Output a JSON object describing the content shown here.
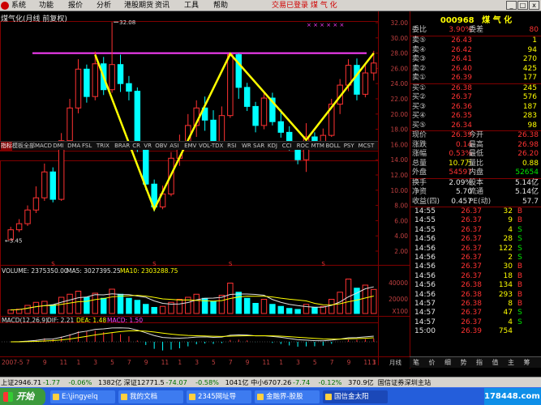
{
  "menubar": {
    "items": [
      "系统",
      "功能",
      "报价",
      "分析",
      "港股期货",
      "资讯",
      "工具",
      "帮助"
    ],
    "status": "交易已登录  煤 气 化",
    "win_min": "_",
    "win_max": "□",
    "win_close": "x"
  },
  "chart": {
    "title": "煤气化(月线 前复权)",
    "high_label": "32.08",
    "low_label": "←3.45",
    "markers": "× × × × × ×",
    "volume_legend": {
      "volume": "VOLUME: 2375350.00",
      "ma5": "MA5: 3027395.25",
      "ma10": "MA10: 2303288.75"
    },
    "macd_legend": {
      "name": "MACD(12,26,9)",
      "dif": "DIF: 2.21",
      "dea": "DEA: 1.48",
      "macd": "MACD: 1.50"
    },
    "bottom_period": "月线",
    "colors": {
      "up": "#ff3232",
      "down": "#00ffff",
      "pattern": "#ffff00",
      "resistance": "#ff40ff",
      "axis": "#800000"
    }
  },
  "chart_data": {
    "type": "candlestick",
    "price_ylim": [
      2,
      32
    ],
    "price_ticks": [
      "32.00",
      "30.00",
      "28.00",
      "26.00",
      "24.00",
      "22.00",
      "20.00",
      "18.00",
      "16.00",
      "14.00",
      "12.00",
      "10.00",
      "8.00",
      "6.00",
      "4.00",
      "2.00"
    ],
    "volume_ticks": [
      "40000",
      "20000",
      "X100"
    ],
    "x_labels": [
      "2007-5",
      "7",
      "9",
      "11",
      "1",
      "3",
      "5",
      "7",
      "9",
      "11",
      "1",
      "3",
      "5",
      "7",
      "9",
      "11",
      "1",
      "3",
      "5",
      "7",
      "9",
      "11",
      "1",
      "3"
    ],
    "resistance_level": 28.0,
    "w_pattern_points": [
      27.8,
      7.5,
      27.9,
      16.6,
      28.0
    ],
    "candles": [
      {
        "o": 3.5,
        "c": 4.8,
        "h": 5.2,
        "l": 3.45
      },
      {
        "o": 4.8,
        "c": 5.6,
        "h": 6.2,
        "l": 4.5
      },
      {
        "o": 5.6,
        "c": 7.4,
        "h": 8.0,
        "l": 5.3
      },
      {
        "o": 7.4,
        "c": 9.0,
        "h": 10.5,
        "l": 7.0
      },
      {
        "o": 9.0,
        "c": 12.4,
        "h": 13.5,
        "l": 8.6
      },
      {
        "o": 12.4,
        "c": 8.8,
        "h": 13.0,
        "l": 8.4
      },
      {
        "o": 8.8,
        "c": 16.5,
        "h": 17.5,
        "l": 8.6
      },
      {
        "o": 16.5,
        "c": 20.8,
        "h": 22.0,
        "l": 16.0
      },
      {
        "o": 20.8,
        "c": 25.9,
        "h": 27.2,
        "l": 20.1
      },
      {
        "o": 25.9,
        "c": 22.3,
        "h": 26.5,
        "l": 21.5
      },
      {
        "o": 22.3,
        "c": 26.6,
        "h": 28.2,
        "l": 21.8
      },
      {
        "o": 26.6,
        "c": 23.2,
        "h": 27.5,
        "l": 22.5
      },
      {
        "o": 23.2,
        "c": 26.5,
        "h": 32.08,
        "l": 22.8
      },
      {
        "o": 26.5,
        "c": 24.0,
        "h": 27.8,
        "l": 22.9
      },
      {
        "o": 24.0,
        "c": 23.0,
        "h": 25.0,
        "l": 21.8
      },
      {
        "o": 23.0,
        "c": 15.5,
        "h": 23.5,
        "l": 15.0
      },
      {
        "o": 15.5,
        "c": 10.8,
        "h": 16.2,
        "l": 10.0
      },
      {
        "o": 10.8,
        "c": 7.8,
        "h": 11.4,
        "l": 7.2
      },
      {
        "o": 7.8,
        "c": 9.5,
        "h": 10.6,
        "l": 7.5
      },
      {
        "o": 9.5,
        "c": 14.2,
        "h": 15.0,
        "l": 9.2
      },
      {
        "o": 14.2,
        "c": 16.0,
        "h": 17.3,
        "l": 13.2
      },
      {
        "o": 16.0,
        "c": 18.5,
        "h": 20.0,
        "l": 15.6
      },
      {
        "o": 18.5,
        "c": 20.8,
        "h": 21.8,
        "l": 17.0
      },
      {
        "o": 20.8,
        "c": 19.2,
        "h": 22.3,
        "l": 17.8
      },
      {
        "o": 19.2,
        "c": 16.4,
        "h": 20.5,
        "l": 15.5
      },
      {
        "o": 16.4,
        "c": 19.8,
        "h": 21.0,
        "l": 16.0
      },
      {
        "o": 19.8,
        "c": 27.8,
        "h": 28.1,
        "l": 19.5
      },
      {
        "o": 27.8,
        "c": 23.5,
        "h": 28.0,
        "l": 22.0
      },
      {
        "o": 23.5,
        "c": 21.0,
        "h": 24.1,
        "l": 20.4
      },
      {
        "o": 21.0,
        "c": 18.5,
        "h": 21.6,
        "l": 17.6
      },
      {
        "o": 18.5,
        "c": 22.1,
        "h": 23.0,
        "l": 18.0
      },
      {
        "o": 22.1,
        "c": 19.0,
        "h": 22.8,
        "l": 18.5
      },
      {
        "o": 19.0,
        "c": 17.6,
        "h": 20.6,
        "l": 16.9
      },
      {
        "o": 17.6,
        "c": 15.6,
        "h": 18.4,
        "l": 15.2
      },
      {
        "o": 15.6,
        "c": 14.0,
        "h": 16.3,
        "l": 13.4
      },
      {
        "o": 14.0,
        "c": 17.0,
        "h": 18.8,
        "l": 12.4
      },
      {
        "o": 17.0,
        "c": 16.3,
        "h": 17.6,
        "l": 15.8
      },
      {
        "o": 16.3,
        "c": 17.2,
        "h": 18.1,
        "l": 15.9
      },
      {
        "o": 17.2,
        "c": 21.3,
        "h": 22.0,
        "l": 17.0
      },
      {
        "o": 21.3,
        "c": 23.8,
        "h": 24.6,
        "l": 20.0
      },
      {
        "o": 23.8,
        "c": 26.4,
        "h": 27.2,
        "l": 23.0
      },
      {
        "o": 26.4,
        "c": 22.6,
        "h": 27.3,
        "l": 21.8
      },
      {
        "o": 22.6,
        "c": 25.4,
        "h": 26.7,
        "l": 22.2
      },
      {
        "o": 25.4,
        "c": 26.7,
        "h": 28.3,
        "l": 24.4
      }
    ],
    "volume": [
      3500,
      4200,
      8000,
      11000,
      12000,
      8500,
      16000,
      19000,
      22000,
      16000,
      20000,
      15000,
      24000,
      19000,
      15000,
      13000,
      9000,
      6000,
      7000,
      11000,
      14000,
      16000,
      19000,
      15000,
      12000,
      18000,
      30000,
      21000,
      15000,
      10000,
      14000,
      9000,
      7000,
      5000,
      4000,
      9000,
      6000,
      7000,
      14000,
      21000,
      34000,
      25000,
      28000,
      23750
    ]
  },
  "indicator_tabs": [
    "指标",
    "模板",
    "全部",
    "MACD",
    "DMI",
    "DMA",
    "FSL",
    "TRIX",
    "BRAR",
    "CR",
    "VR",
    "OBV",
    "ASI",
    "EMV",
    "VOL-TDX",
    "RSI",
    "WR",
    "SAR",
    "KDJ",
    "CCI",
    "ROC",
    "MTM",
    "BOLL",
    "PSY",
    "MCST"
  ],
  "quote": {
    "code": "000968",
    "name": "煤 气 化",
    "webi_label": "委比",
    "webi": "3.90%",
    "weicha_label": "委差",
    "weicha": "80",
    "sells": [
      {
        "label": "卖⑤",
        "price": "26.43",
        "vol": "1"
      },
      {
        "label": "卖④",
        "price": "26.42",
        "vol": "94"
      },
      {
        "label": "卖③",
        "price": "26.41",
        "vol": "270"
      },
      {
        "label": "卖②",
        "price": "26.40",
        "vol": "425"
      },
      {
        "label": "卖①",
        "price": "26.39",
        "vol": "177"
      }
    ],
    "buys": [
      {
        "label": "买①",
        "price": "26.38",
        "vol": "245"
      },
      {
        "label": "买②",
        "price": "26.37",
        "vol": "576"
      },
      {
        "label": "买③",
        "price": "26.36",
        "vol": "187"
      },
      {
        "label": "买④",
        "price": "26.35",
        "vol": "283"
      },
      {
        "label": "买⑤",
        "price": "26.34",
        "vol": "98"
      }
    ],
    "stats": [
      {
        "l1": "现价",
        "v1": "26.39",
        "c1": "red",
        "l2": "今开",
        "v2": "26.38",
        "c2": "red"
      },
      {
        "l1": "涨跌",
        "v1": "0.14",
        "c1": "red",
        "l2": "最高",
        "v2": "26.98",
        "c2": "red"
      },
      {
        "l1": "涨幅",
        "v1": "0.53%",
        "c1": "red",
        "l2": "最低",
        "v2": "26.20",
        "c2": "red"
      },
      {
        "l1": "总量",
        "v1": "10.7万",
        "c1": "yellow",
        "l2": "量比",
        "v2": "0.88",
        "c2": "yellow"
      },
      {
        "l1": "外盘",
        "v1": "54597",
        "c1": "red",
        "l2": "内盘",
        "v2": "52654",
        "c2": "green"
      }
    ],
    "stats2": [
      {
        "l1": "换手",
        "v1": "2.09%",
        "c1": "white",
        "l2": "股本",
        "v2": "5.14亿",
        "c2": "white"
      },
      {
        "l1": "净资",
        "v1": "5.70",
        "c1": "white",
        "l2": "流通",
        "v2": "5.14亿",
        "c2": "white"
      },
      {
        "l1": "收益(四)",
        "v1": "0.457",
        "c1": "white",
        "l2": "PE(动)",
        "v2": "57.7",
        "c2": "white"
      }
    ],
    "ticks": [
      {
        "t": "14:55",
        "p": "26.37",
        "v": "32",
        "bs": "B",
        "c": "red"
      },
      {
        "t": "14:55",
        "p": "26.37",
        "v": "9",
        "bs": "B",
        "c": "red"
      },
      {
        "t": "14:55",
        "p": "26.37",
        "v": "4",
        "bs": "S",
        "c": "green"
      },
      {
        "t": "14:56",
        "p": "26.37",
        "v": "28",
        "bs": "S",
        "c": "green"
      },
      {
        "t": "14:56",
        "p": "26.37",
        "v": "122",
        "bs": "S",
        "c": "green"
      },
      {
        "t": "14:56",
        "p": "26.37",
        "v": "2",
        "bs": "S",
        "c": "green"
      },
      {
        "t": "14:56",
        "p": "26.37",
        "v": "30",
        "bs": "B",
        "c": "red"
      },
      {
        "t": "14:56",
        "p": "26.37",
        "v": "18",
        "bs": "B",
        "c": "red"
      },
      {
        "t": "14:56",
        "p": "26.38",
        "v": "134",
        "bs": "B",
        "c": "red"
      },
      {
        "t": "14:56",
        "p": "26.38",
        "v": "293",
        "bs": "B",
        "c": "red"
      },
      {
        "t": "14:57",
        "p": "26.38",
        "v": "8",
        "bs": "B",
        "c": "red"
      },
      {
        "t": "14:57",
        "p": "26.37",
        "v": "47",
        "bs": "S",
        "c": "green"
      },
      {
        "t": "14:57",
        "p": "26.37",
        "v": "4",
        "bs": "S",
        "c": "green"
      },
      {
        "t": "15:00",
        "p": "26.39",
        "v": "754",
        "bs": "",
        "c": "red"
      }
    ],
    "right_tabs": [
      "笔",
      "价",
      "细",
      "势",
      "指",
      "值",
      "主",
      "筹"
    ]
  },
  "index_bar": [
    {
      "text": "上证2946.71",
      "c": "#000"
    },
    {
      "text": "-1.77",
      "c": "#007000"
    },
    {
      "text": "-0.06%",
      "c": "#007000"
    },
    {
      "text": "1382亿",
      "c": "#000"
    },
    {
      "text": "深证12771.5",
      "c": "#000"
    },
    {
      "text": "-74.07",
      "c": "#007000"
    },
    {
      "text": "-0.58%",
      "c": "#007000"
    },
    {
      "text": "1041亿",
      "c": "#000"
    },
    {
      "text": "中小6707.26",
      "c": "#000"
    },
    {
      "text": "-7.74",
      "c": "#007000"
    },
    {
      "text": "-0.12%",
      "c": "#007000"
    },
    {
      "text": "370.9亿",
      "c": "#000"
    },
    {
      "text": "国信证券深圳主站",
      "c": "#000"
    }
  ],
  "taskbar": {
    "start": "开始",
    "tasks": [
      "E:\\jingyelq",
      "我的文档",
      "2345网址导",
      "金融界-股股",
      "国信金太阳"
    ],
    "tray": "178448.com"
  }
}
